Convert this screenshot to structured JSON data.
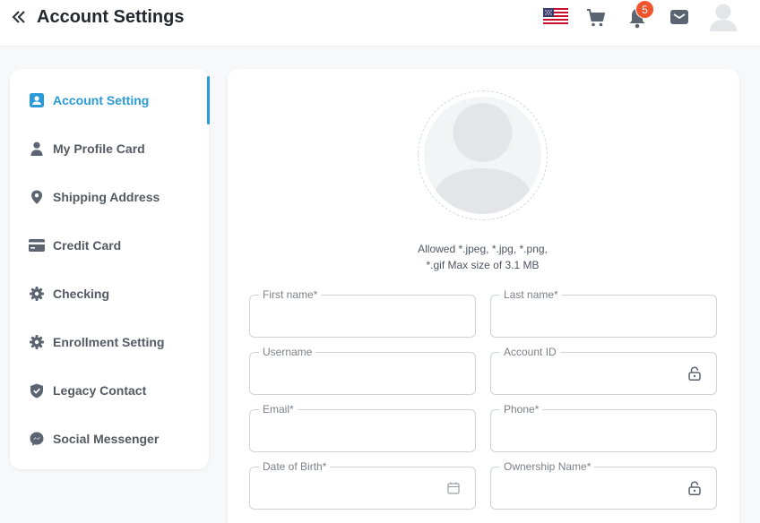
{
  "header": {
    "title": "Account Settings",
    "back_icon": "double-chevron-left-icon",
    "icons": [
      "us-flag-icon",
      "cart-icon",
      "bell-icon",
      "mail-icon",
      "user-avatar-icon"
    ],
    "notification_count": "5"
  },
  "sidebar": {
    "active_color": "#2b9bd8",
    "items": [
      {
        "label": "Account Setting",
        "icon": "account-box-icon"
      },
      {
        "label": "My Profile Card",
        "icon": "person-icon"
      },
      {
        "label": "Shipping Address",
        "icon": "location-pin-icon"
      },
      {
        "label": "Credit Card",
        "icon": "credit-card-icon"
      },
      {
        "label": "Checking",
        "icon": "gear-icon"
      },
      {
        "label": "Enrollment Setting",
        "icon": "gear-icon"
      },
      {
        "label": "Legacy Contact",
        "icon": "shield-check-icon"
      },
      {
        "label": "Social Messenger",
        "icon": "messenger-icon"
      }
    ]
  },
  "profile": {
    "upload_hint_line1": "Allowed *.jpeg, *.jpg, *.png,",
    "upload_hint_line2": "*.gif Max size of 3.1 MB"
  },
  "form": {
    "first_name": {
      "label": "First name*",
      "value": ""
    },
    "last_name": {
      "label": "Last name*",
      "value": ""
    },
    "username": {
      "label": "Username",
      "value": ""
    },
    "account_id": {
      "label": "Account ID",
      "value": ""
    },
    "email": {
      "label": "Email*",
      "value": ""
    },
    "phone": {
      "label": "Phone*",
      "value": ""
    },
    "dob": {
      "label": "Date of Birth*",
      "value": ""
    },
    "ownership_name": {
      "label": "Ownership Name*",
      "value": ""
    }
  }
}
